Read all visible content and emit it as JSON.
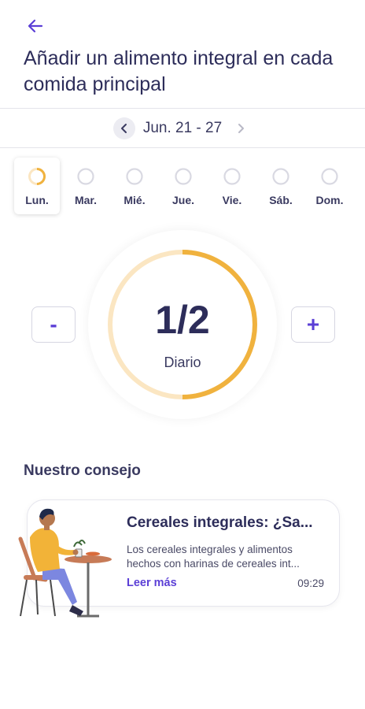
{
  "header": {
    "title": "Añadir un alimento integral en cada comida principal"
  },
  "week": {
    "label": "Jun. 21 - 27"
  },
  "days": [
    {
      "label": "Lun.",
      "selected": true,
      "progress": 0.5
    },
    {
      "label": "Mar.",
      "selected": false,
      "progress": 0
    },
    {
      "label": "Mié.",
      "selected": false,
      "progress": 0
    },
    {
      "label": "Jue.",
      "selected": false,
      "progress": 0
    },
    {
      "label": "Vie.",
      "selected": false,
      "progress": 0
    },
    {
      "label": "Sáb.",
      "selected": false,
      "progress": 0
    },
    {
      "label": "Dom.",
      "selected": false,
      "progress": 0
    }
  ],
  "counter": {
    "value": "1/2",
    "unit": "Diario",
    "progress": 0.5
  },
  "controls": {
    "minus_label": "-",
    "plus_label": "+"
  },
  "advice": {
    "section_title": "Nuestro consejo",
    "card": {
      "title": "Cereales integrales: ¿Sa...",
      "body": "Los cereales integrales y alimentos hechos con harinas de cereales int...",
      "link": "Leer más",
      "time": "09:29"
    }
  },
  "colors": {
    "accent": "#5b3fd6",
    "progress": "#f0b23e",
    "progress_track": "#fbe6c2",
    "ring_empty": "#d9d9e2",
    "text": "#2d2d5a"
  },
  "icons": {
    "back": "arrow-left-icon",
    "prev": "chevron-left-icon",
    "next": "chevron-right-icon"
  }
}
